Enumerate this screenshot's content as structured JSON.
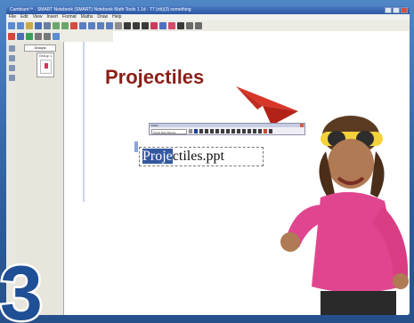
{
  "window": {
    "title": "Cambium™ · SMART Notebook (SMART) Notebook Math Tools 1.1d · T7 (nb)(3) something"
  },
  "menubar": {
    "items": [
      "File",
      "Edit",
      "View",
      "Insert",
      "Format",
      "Maths",
      "Draw",
      "Help"
    ]
  },
  "sorter": {
    "tab_label": "Groups",
    "group_label": "Group 1"
  },
  "slide": {
    "heading": "Projectiles",
    "textbox_selected": "Proje",
    "textbox_rest": "ctiles.ppt"
  },
  "font_toolbar": {
    "title": "Fonts",
    "font_name": "Times New Roman"
  },
  "badge": {
    "number": "3"
  },
  "colors": {
    "heading": "#8b1f18",
    "bezel": "#3a6aa8",
    "selection": "#33589f",
    "plane": "#d9362a",
    "shirt": "#e0468f"
  }
}
